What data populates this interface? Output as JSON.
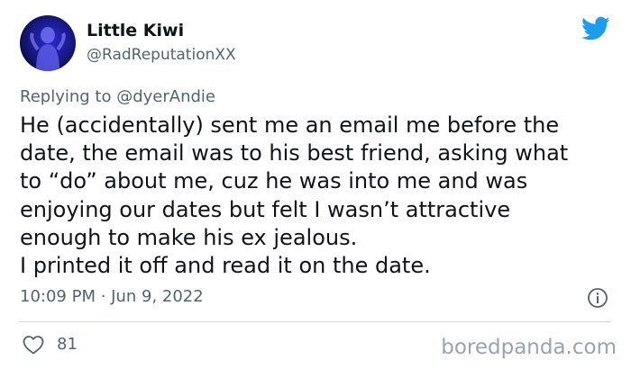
{
  "tweet": {
    "author_name": "Little Kiwi",
    "author_handle": "@RadReputationXX",
    "reply_prefix": "Replying to ",
    "reply_mention": "@dyerAndie",
    "text": "He (accidentally) sent me an email me before the\ndate, the email was to his best friend, asking what\nto “do” about me, cuz he was into me and was\nenjoying our dates but felt I wasn’t attractive\nenough to make his ex jealous.\nI printed it off and read it on the date.",
    "timestamp": "10:09 PM · Jun 9, 2022",
    "like_count": "81"
  },
  "watermark": "boredpanda.com",
  "icons": {
    "brand": "twitter-bird-icon",
    "info": "info-icon",
    "like": "heart-icon"
  },
  "colors": {
    "brand_blue": "#1d9bf0",
    "secondary_text": "#536471",
    "primary_text": "#0f1419",
    "divider": "#cfd9de"
  }
}
